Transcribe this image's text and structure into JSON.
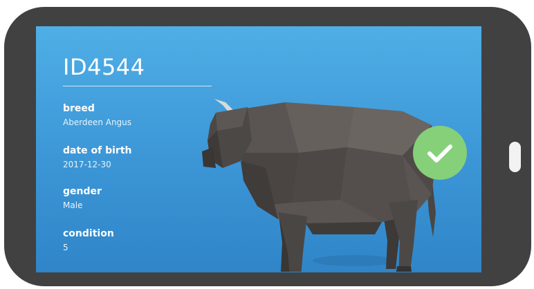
{
  "animal": {
    "id": "ID4544"
  },
  "fields": [
    {
      "label": "breed",
      "value": "Aberdeen Angus"
    },
    {
      "label": "date of birth",
      "value": "2017-12-30"
    },
    {
      "label": "gender",
      "value": "Male"
    },
    {
      "label": "condition",
      "value": "5"
    }
  ],
  "status": {
    "icon": "checkmark-icon",
    "color": "#86d07a"
  },
  "colors": {
    "frame": "#414141",
    "screen": "#3f9bd9",
    "text": "#ffffff"
  }
}
